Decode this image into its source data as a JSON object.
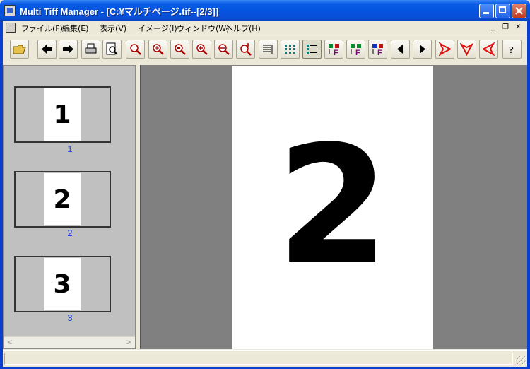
{
  "window": {
    "title": "Multi Tiff Manager - [C:¥マルチページ.tif--[2/3]]"
  },
  "menubar": {
    "items": [
      {
        "label": "ファイル(F)"
      },
      {
        "label": "編集(E)"
      },
      {
        "label": "表示(V)"
      },
      {
        "label": "イメージ(I)"
      },
      {
        "label": "ウィンドウ(W)"
      },
      {
        "label": "ヘルプ(H)"
      }
    ]
  },
  "toolbar": {
    "tools": [
      {
        "icon": "open-folder-icon"
      },
      {
        "icon": "arrow-left-icon"
      },
      {
        "icon": "arrow-right-icon"
      },
      {
        "icon": "print-icon"
      },
      {
        "icon": "print-preview-icon"
      },
      {
        "icon": "zoom-icon"
      },
      {
        "icon": "zoom-fit-icon"
      },
      {
        "icon": "zoom-actual-icon"
      },
      {
        "icon": "zoom-in-icon"
      },
      {
        "icon": "zoom-out-icon"
      },
      {
        "icon": "zoom-custom-icon"
      },
      {
        "icon": "view-list-icon"
      },
      {
        "icon": "view-thumbnails-icon"
      },
      {
        "icon": "view-details-icon"
      },
      {
        "icon": "page-move-up-icon"
      },
      {
        "icon": "page-move-down-icon"
      },
      {
        "icon": "page-insert-icon"
      },
      {
        "icon": "prev-page-icon"
      },
      {
        "icon": "next-page-icon"
      },
      {
        "icon": "rotate-right-icon"
      },
      {
        "icon": "rotate-down-icon"
      },
      {
        "icon": "rotate-left-icon"
      },
      {
        "icon": "help-icon"
      }
    ]
  },
  "thumbnails": [
    {
      "page_glyph": "1",
      "label": "1"
    },
    {
      "page_glyph": "2",
      "label": "2"
    },
    {
      "page_glyph": "3",
      "label": "3"
    }
  ],
  "viewer": {
    "page_glyph": "2"
  },
  "statusbar": {
    "text": ""
  },
  "colors": {
    "titlebar": "#0a5ce6",
    "thumb_label": "#1a3fe6",
    "viewer_bg": "#808080",
    "rotate_icons": "#e01010"
  }
}
